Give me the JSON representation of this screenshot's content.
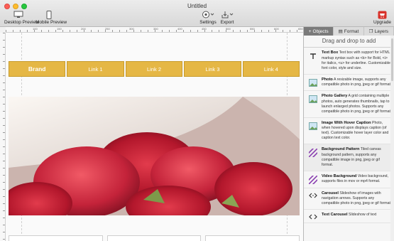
{
  "window": {
    "title": "Untitled"
  },
  "toolbar": {
    "desktop_preview": "Desktop Preview",
    "mobile_preview": "Mobile Preview",
    "settings": "Settings",
    "export": "Export",
    "upgrade": "Upgrade"
  },
  "ruler": {
    "ticks": [
      "100",
      "150",
      "200",
      "250",
      "300",
      "350",
      "400",
      "450",
      "500",
      "550",
      "600",
      "650",
      "700",
      "750",
      "800",
      "850",
      "900"
    ]
  },
  "nav": {
    "items": [
      "Brand",
      "Link 1",
      "Link 2",
      "Link 3",
      "Link 4"
    ]
  },
  "hero": {
    "image_icon": "roses-photo"
  },
  "panel": {
    "tabs": [
      "Objects",
      "Format",
      "Layers"
    ],
    "hint": "Drag and drop to add",
    "items": [
      {
        "name": "Text Box",
        "desc": "Text box with support for HTML markup syntax such as <b> for Bold, <i> for italics, <u> for underline. Customizable font color, style and size."
      },
      {
        "name": "Photo",
        "desc": "A resizable image, supports any compatible photo in png, jpeg or gif format."
      },
      {
        "name": "Photo Gallery",
        "desc": "A grid containing multiple photos, auto generates thumbnails, tap to launch enlarged photos. Supports any compatible photo in png, jpeg or gif format."
      },
      {
        "name": "Image With Hover Caption",
        "desc": "Photo, when hovered upon displays caption (of text). Customizable hover layer color and caption text color."
      },
      {
        "name": "Background Pattern",
        "desc": "Tiled canvas background pattern, supports any compatible image in png, jpeg or gif format."
      },
      {
        "name": "Video Background",
        "desc": "Video background, supports files in mov or mp4 format."
      },
      {
        "name": "Carousel",
        "desc": "Slideshow of images with navigation arrows. Supports any compatible photo in png, jpeg or gif format."
      },
      {
        "name": "Text Carousel",
        "desc": "Slideshow of text"
      }
    ]
  },
  "colors": {
    "nav_bg": "#e5b745",
    "tab_active": "#7a7a7a"
  }
}
